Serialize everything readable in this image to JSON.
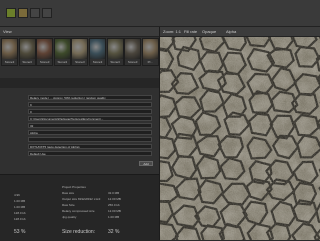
{
  "toolbar": {},
  "left_panel": {
    "tab": "View",
    "thumbnails": [
      {
        "label": "Stone3",
        "color": "#6a5a44"
      },
      {
        "label": "Stone3",
        "color": "#4e4a3a"
      },
      {
        "label": "Stone3",
        "color": "#5e4234"
      },
      {
        "label": "Stone3",
        "color": "#3d4a2a"
      },
      {
        "label": "Stone3",
        "color": "#746a55"
      },
      {
        "label": "Stone3",
        "color": "#3a4e58"
      },
      {
        "label": "Stone3",
        "color": "#55523f"
      },
      {
        "label": "Stone3",
        "color": "#4a453c"
      },
      {
        "label": "Pr...",
        "color": "#6b5d48"
      }
    ],
    "properties": [
      {
        "label": "",
        "value": "Relaxy mode | ... Approx. 50% reduction | random quality"
      },
      {
        "label": "",
        "value": "9"
      },
      {
        "label": "",
        "value": "0"
      },
      {
        "label": "",
        "value": "C:\\Users\\Documents\\Package\\Textures\\Environment\\..."
      },
      {
        "label": "",
        "value": "32"
      },
      {
        "label": "",
        "value": "Alpha"
      },
      {
        "label": "",
        "value": ""
      },
      {
        "label": "",
        "value": "DXT1/DXT5 (auto detection of Alpha)"
      },
      {
        "label": "",
        "value": "Default Use"
      }
    ],
    "apply_label": "Add"
  },
  "stats": {
    "left": [
      {
        "label": "",
        "value": "4.96"
      },
      {
        "label": "",
        "value": "1.00 MB"
      },
      {
        "label": "",
        "value": "1.00 MB"
      },
      {
        "label": "",
        "value": "128.0 kb"
      },
      {
        "label": "",
        "value": "128.0 kb"
      }
    ],
    "left_big": "53 %",
    "right_title": "Project Properties",
    "right": [
      {
        "label": "Raw size",
        "value": "32.0 MB"
      },
      {
        "label": "Output size 8192x8192 x1x4:",
        "value": "12.00 MB"
      },
      {
        "label": "Raw Size",
        "value": "256.0 kb"
      },
      {
        "label": "Relaxy compressed size",
        "value": "12.00 MB"
      },
      {
        "label": "Jpg quality",
        "value": "1.00 MB"
      },
      {
        "label": "Size reduction:",
        "value": "32 %"
      }
    ]
  },
  "view": {
    "header_left": "Zoom: 1:1",
    "header_mid": "Fill rate",
    "header_mode": "Opaque",
    "header_right": "Alpha"
  }
}
